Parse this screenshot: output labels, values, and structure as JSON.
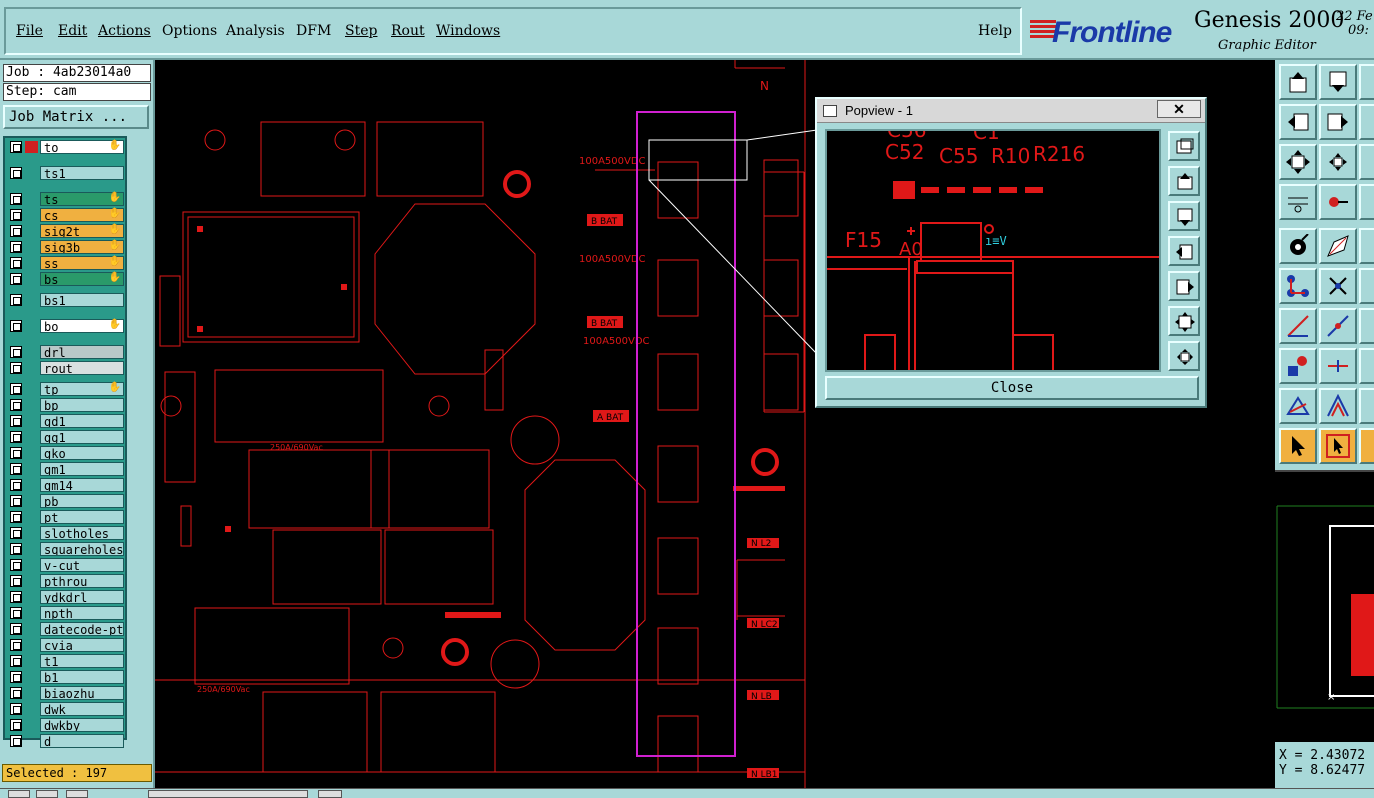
{
  "menu": {
    "items": [
      "File",
      "Edit",
      "Actions",
      "Options",
      "Analysis",
      "DFM",
      "Step",
      "Rout",
      "Windows"
    ],
    "help": "Help"
  },
  "brand": {
    "logo": "Frontline",
    "product": "Genesis 2000",
    "subtitle": "Graphic Editor",
    "date_line1": "22 Fe",
    "date_line2": "09:"
  },
  "left": {
    "job": "Job : 4ab23014a0",
    "step": "Step: cam",
    "job_matrix": "Job Matrix ...",
    "selected": "Selected : 197"
  },
  "layers": [
    {
      "name": "to",
      "color": "white",
      "flags": "hand-grid"
    },
    {
      "name": "ts1",
      "color": "default"
    },
    {
      "name": "ts",
      "color": "green",
      "flags": "hand"
    },
    {
      "name": "cs",
      "color": "orange",
      "flags": "hand"
    },
    {
      "name": "sig2t",
      "color": "orange",
      "flags": "hand"
    },
    {
      "name": "sig3b",
      "color": "orange",
      "flags": "hand"
    },
    {
      "name": "ss",
      "color": "orange",
      "flags": "hand"
    },
    {
      "name": "bs",
      "color": "green",
      "flags": "hand"
    },
    {
      "name": "bs1",
      "color": "default"
    },
    {
      "name": "bo",
      "color": "white",
      "flags": "hand"
    },
    {
      "name": "drl",
      "color": "gray"
    },
    {
      "name": "rout",
      "color": "lgray"
    },
    {
      "name": "tp",
      "color": "default",
      "flags": "hand"
    },
    {
      "name": "bp",
      "color": "default"
    },
    {
      "name": "gd1",
      "color": "default"
    },
    {
      "name": "gg1",
      "color": "default"
    },
    {
      "name": "gko",
      "color": "default"
    },
    {
      "name": "gm1",
      "color": "default"
    },
    {
      "name": "gm14",
      "color": "default"
    },
    {
      "name": "pb",
      "color": "default"
    },
    {
      "name": "pt",
      "color": "default"
    },
    {
      "name": "slotholes",
      "color": "default"
    },
    {
      "name": "squareholes",
      "color": "default"
    },
    {
      "name": "v-cut",
      "color": "default"
    },
    {
      "name": "pthrou",
      "color": "default"
    },
    {
      "name": "ydkdrl",
      "color": "default"
    },
    {
      "name": "npth",
      "color": "default"
    },
    {
      "name": "datecode-pt",
      "color": "default"
    },
    {
      "name": "cvia",
      "color": "default"
    },
    {
      "name": "t1",
      "color": "default"
    },
    {
      "name": "b1",
      "color": "default"
    },
    {
      "name": "biaozhu",
      "color": "default"
    },
    {
      "name": "dwk",
      "color": "default"
    },
    {
      "name": "dwkby",
      "color": "default"
    },
    {
      "name": "d",
      "color": "default"
    }
  ],
  "popview": {
    "title": "Popview - 1",
    "close_label": "Close",
    "close_x": "✕",
    "labels": {
      "c52": "C52",
      "c55": "C55",
      "r10": "R10",
      "r216": "R216",
      "f15": "F15",
      "a0": "A0",
      "ghost1": "C56",
      "ghost2": "C1"
    }
  },
  "canvas_labels": {
    "n_top": "N",
    "rating1": "100A500VDC",
    "rating2": "100A500VDC",
    "rating3": "100A500VDC",
    "rating4": "250A/690Vac",
    "rating5": "250A/690Vac",
    "bat1": "B BAT",
    "bat2": "B BAT",
    "bat3": "A BAT",
    "nl1": "N L2",
    "nl2": "N LC2",
    "nl3": "N LB",
    "nl4": "N LB1"
  },
  "coords": {
    "x": "X = 2.43072",
    "y": "Y = 8.62477"
  },
  "colors": {
    "panel": "#a8d8d8",
    "pcb_red": "#e01818",
    "highlight": "#d020d0",
    "layer_green": "#2a9a6a",
    "layer_orange": "#f0b040"
  }
}
